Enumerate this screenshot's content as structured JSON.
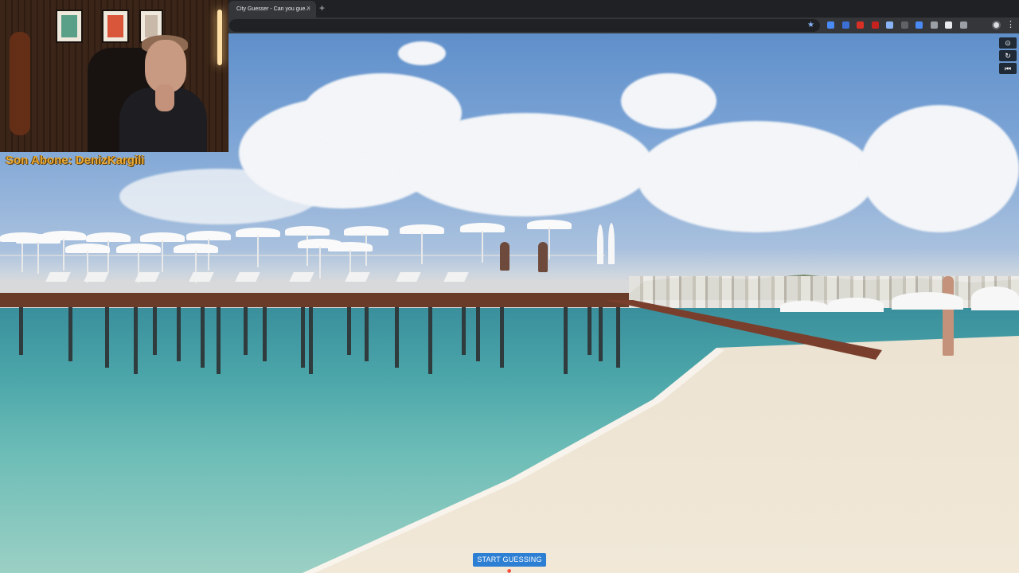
{
  "browser": {
    "tab_title": "City Guesser - Can you gue...",
    "tab_close": "×",
    "new_tab": "+",
    "bookmark_icon": "star-icon",
    "menu_icon": "⋮",
    "extension_colors": [
      "#4a8af4",
      "#3b6fd6",
      "#d93025",
      "#c5221f",
      "#8ab4f8",
      "#5f6368",
      "#4a8af4",
      "#9aa0a6",
      "#e8eaed",
      "#9aa0a6"
    ]
  },
  "overlay": {
    "side_controls": [
      {
        "name": "compass-icon",
        "glyph": "⊙"
      },
      {
        "name": "refresh-icon",
        "glyph": "↻"
      },
      {
        "name": "skip-back-icon",
        "glyph": "⏮"
      }
    ],
    "start_button": "START GUESSING 📍"
  },
  "stream": {
    "last_subscriber": "Son Abone: DenizKargili"
  }
}
